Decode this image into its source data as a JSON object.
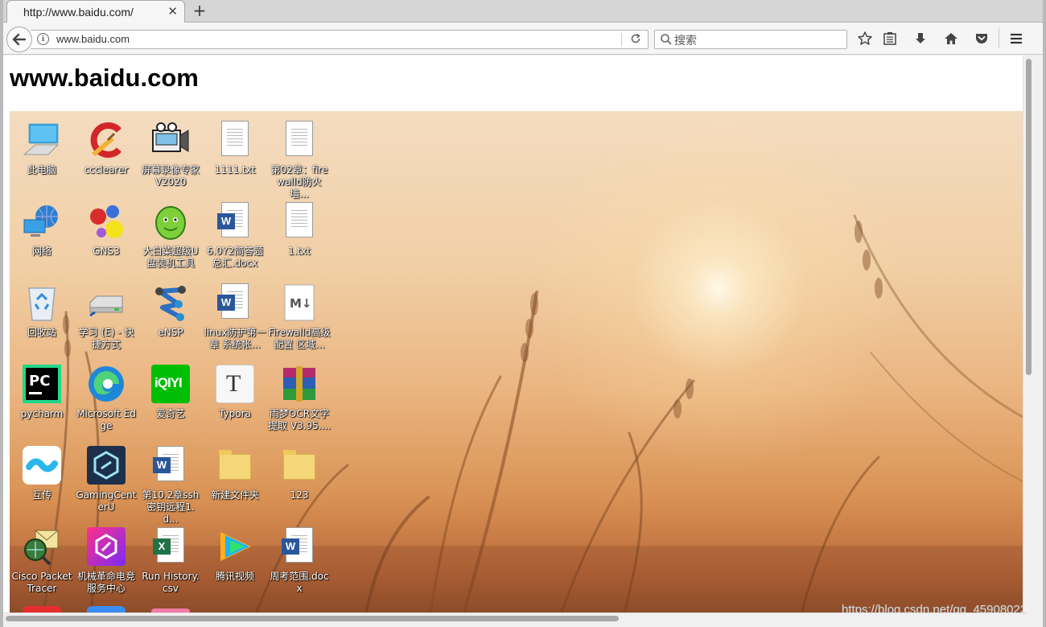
{
  "browser": {
    "tab_title": "http://www.baidu.com/",
    "tab_close_glyph": "✕",
    "new_tab_glyph": "+",
    "url": "www.baidu.com",
    "search_placeholder": "搜索"
  },
  "page": {
    "heading": "www.baidu.com"
  },
  "desktop_icons": [
    {
      "label": "此电脑",
      "icon": "computer-icon"
    },
    {
      "label": "ccclearer",
      "icon": "ccleaner-icon"
    },
    {
      "label": "屏幕录像专家V2020",
      "icon": "film-recorder-icon"
    },
    {
      "label": "1111.txt",
      "icon": "text-file-icon"
    },
    {
      "label": "第02章：firewalld防火墙...",
      "icon": "text-file-icon"
    },
    {
      "label": "网络",
      "icon": "network-icon"
    },
    {
      "label": "GNS3",
      "icon": "gns3-icon"
    },
    {
      "label": "大白菜超级U盘装机工具",
      "icon": "cabbage-icon"
    },
    {
      "label": "6.0Y2简答题总汇.docx",
      "icon": "word-file-icon"
    },
    {
      "label": "1.txt",
      "icon": "text-file-icon"
    },
    {
      "label": "回收站",
      "icon": "recycle-bin-icon"
    },
    {
      "label": "学习 (E) - 快捷方式",
      "icon": "drive-icon"
    },
    {
      "label": "eNSP",
      "icon": "ensp-icon"
    },
    {
      "label": "linux防护第一章 系统帐...",
      "icon": "word-file-icon"
    },
    {
      "label": "Firewalld高级配置 区域...",
      "icon": "markdown-file-icon"
    },
    {
      "label": "pycharm",
      "icon": "pycharm-icon"
    },
    {
      "label": "Microsoft Edge",
      "icon": "edge-icon"
    },
    {
      "label": "爱奇艺",
      "icon": "iqiyi-icon"
    },
    {
      "label": "Typora",
      "icon": "typora-icon"
    },
    {
      "label": "雨梦OCR文字提取 V3.95....",
      "icon": "winrar-icon"
    },
    {
      "label": "互传",
      "icon": "hutuan-icon"
    },
    {
      "label": "GamingCenterU",
      "icon": "gaming-center-icon"
    },
    {
      "label": "第10.2章ssh密钥远程1.d...",
      "icon": "word-file-icon"
    },
    {
      "label": "新建文件夹",
      "icon": "folder-icon"
    },
    {
      "label": "123",
      "icon": "folder-icon"
    },
    {
      "label": "Cisco Packet Tracer",
      "icon": "packet-tracer-icon"
    },
    {
      "label": "机械革命电竞服务中心",
      "icon": "mechrevo-icon"
    },
    {
      "label": "Run History.csv",
      "icon": "excel-file-icon"
    },
    {
      "label": "腾讯视频",
      "icon": "tencent-video-icon"
    },
    {
      "label": "周考范围.docx",
      "icon": "word-file-icon"
    }
  ],
  "watermark": "https://blog.csdn.net/qq_45908022",
  "colors": {
    "word_blue": "#2b579a",
    "excel_green": "#217346",
    "iqiyi_green": "#00be06",
    "pycharm_green": "#21d789"
  }
}
